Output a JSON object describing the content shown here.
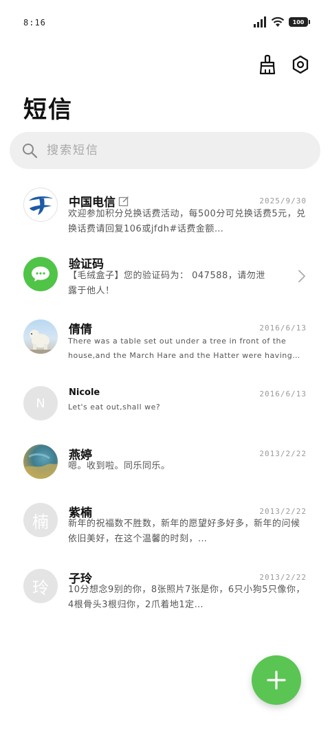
{
  "status": {
    "time": "8:16",
    "battery": "100"
  },
  "page": {
    "title": "短信"
  },
  "search": {
    "placeholder": "搜索短信"
  },
  "conversations": [
    {
      "name": "中国电信",
      "date": "2025/9/30",
      "preview": "欢迎参加积分兑换话费活动，每500分可兑换话费5元，兑换话费请回复106或jfdh#话费金额…",
      "avatar": "china-telecom-logo"
    },
    {
      "name": "验证码",
      "date": "",
      "preview": "【毛绒盒子】您的验证码为： 047588，请勿泄露于他人！",
      "avatar": "message-bubble-icon"
    },
    {
      "name": "倩倩",
      "date": "2016/6/13",
      "preview": "There was a table set out under a tree in front of the house,and the March Hare and the Hatter were having tea at it.",
      "avatar": "polar-bear-photo"
    },
    {
      "name": "Nicole",
      "date": "2016/6/13",
      "preview": "Let's eat out,shall we?",
      "avatar_letter": "N"
    },
    {
      "name": "燕婷",
      "date": "2013/2/22",
      "preview": "嗯。收到啦。同乐同乐。",
      "avatar": "landscape-photo"
    },
    {
      "name": "紫楠",
      "date": "2013/2/22",
      "preview": "新年的祝福数不胜数，新年的愿望好多好多，新年的问候依旧美好，在这个温馨的时刻，…",
      "avatar_letter": "楠"
    },
    {
      "name": "子玲",
      "date": "2013/2/22",
      "preview": "10分想念9别的你，8张照片7张是你，6只小狗5只像你，4根骨头3根归你，2爪着地1定…",
      "avatar_letter": "玲"
    }
  ],
  "colors": {
    "accent": "#5ac553",
    "telecom_blue": "#1d5aa8"
  }
}
